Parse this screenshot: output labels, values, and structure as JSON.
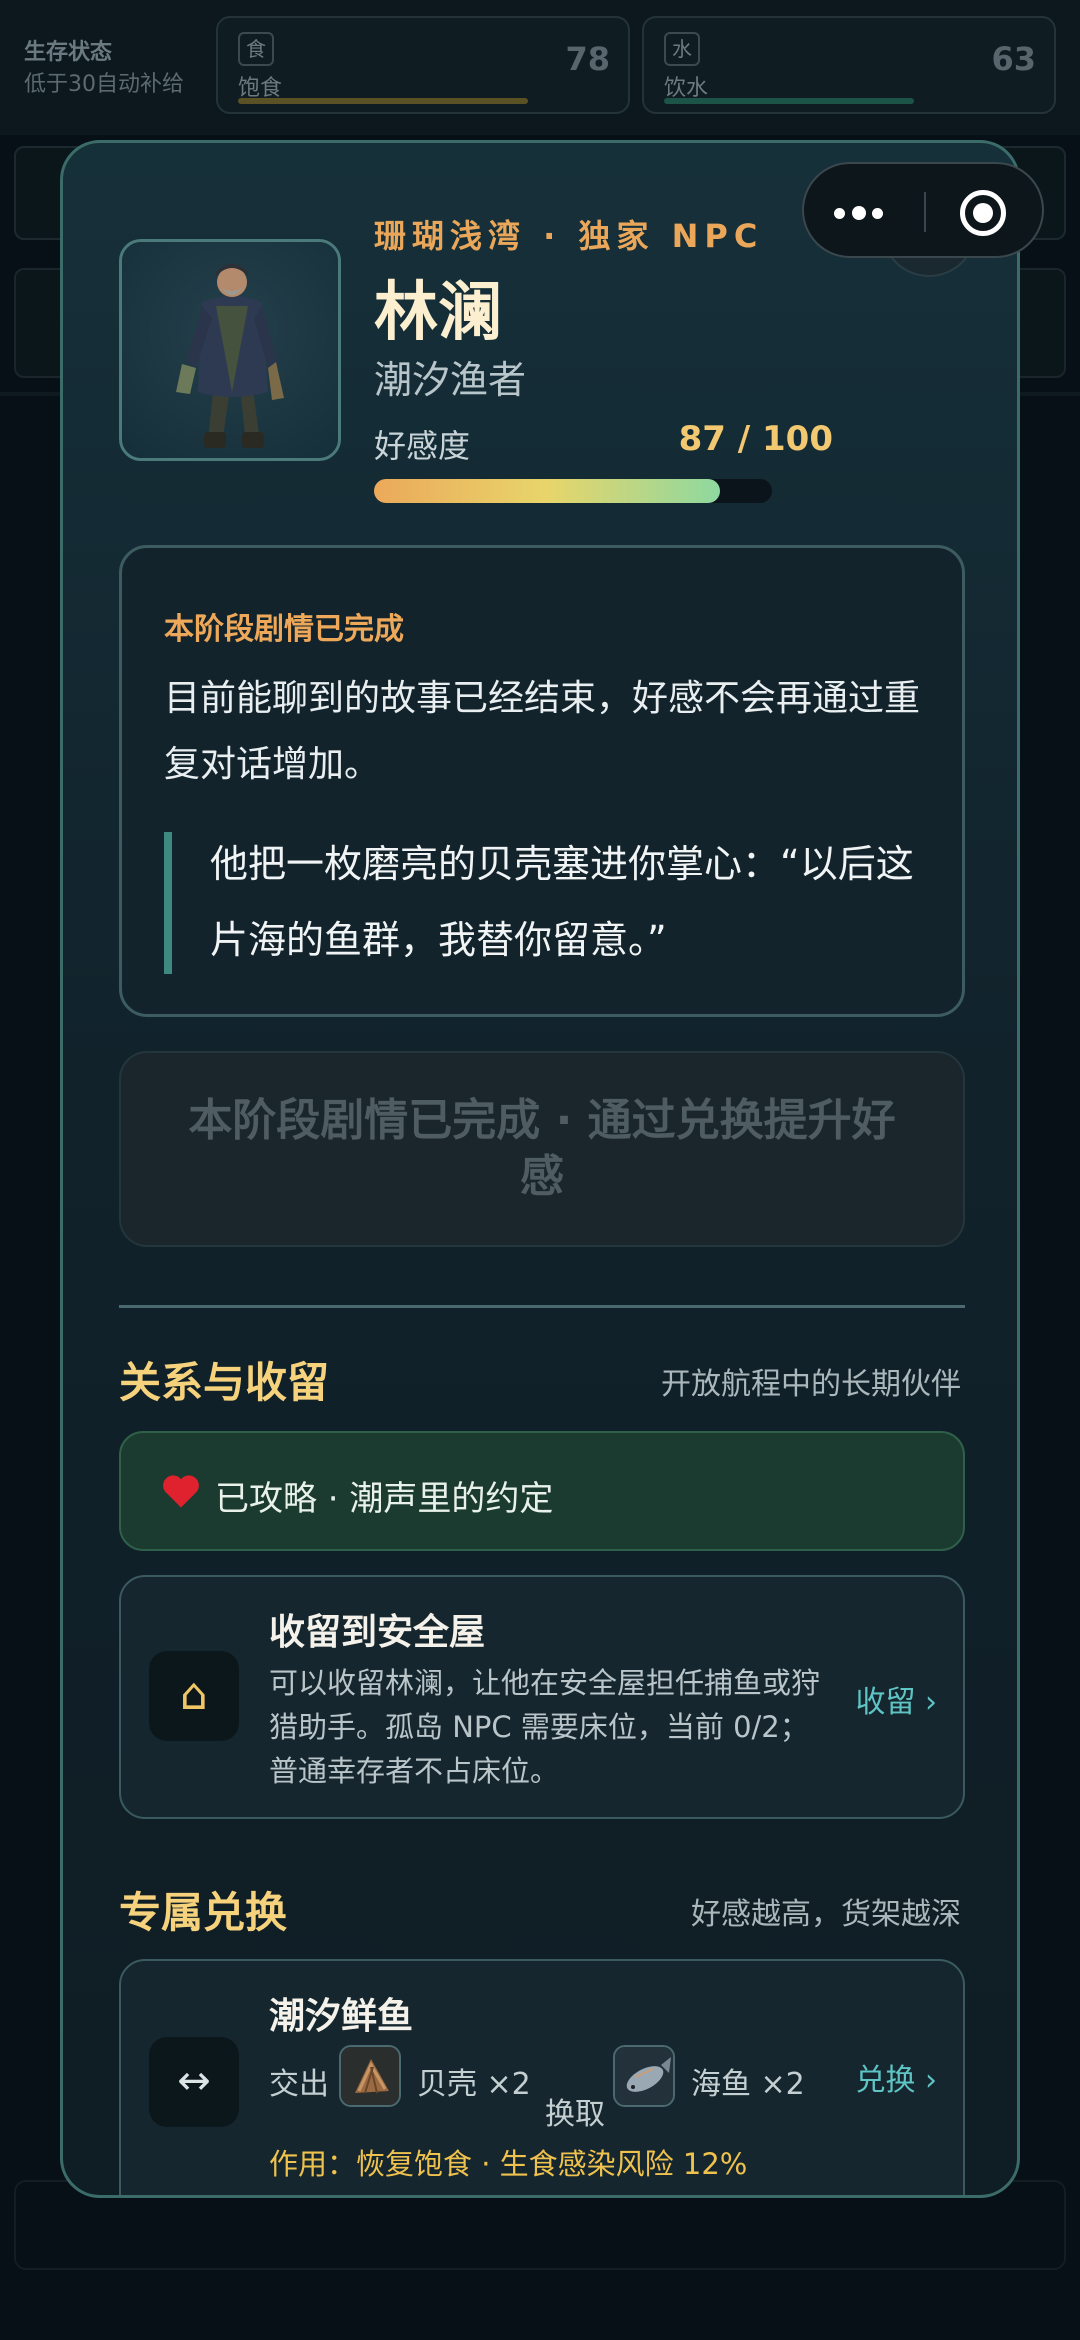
{
  "background": {
    "status_label": "生存状态",
    "status_sub": "低于30自动补给",
    "meters": [
      {
        "icon": "食",
        "name": "饱食",
        "value": "78"
      },
      {
        "icon": "水",
        "name": "饮水",
        "value": "63"
      }
    ]
  },
  "capsule": {
    "more": "more-icon",
    "close": "target-icon"
  },
  "npc": {
    "region": "珊瑚浅湾 · 独家 NPC",
    "name": "林澜",
    "role": "潮汐渔者",
    "affinity_label": "好感度",
    "affinity_text": "87 / 100",
    "affinity_value": 87,
    "affinity_max": 100
  },
  "story": {
    "title": "本阶段剧情已完成",
    "desc": "目前能聊到的故事已经结束，好感不会再通过重复对话增加。",
    "quote": "他把一枚磨亮的贝壳塞进你掌心：“以后这片海的鱼群，我替你留意。”"
  },
  "exchange_button": "本阶段剧情已完成 · 通过兑换提升好感",
  "relation": {
    "title": "关系与收留",
    "hint": "开放航程中的长期伙伴",
    "bond": "已攻略 · 潮声里的约定",
    "shelter_title": "收留到安全屋",
    "shelter_desc": "可以收留林澜，让他在安全屋担任捕鱼或狩猎助手。孤岛 NPC 需要床位，当前 0/2；普通幸存者不占床位。",
    "shelter_action": "收留 ›",
    "shelter_icon": "⌂"
  },
  "trade": {
    "title": "专属兑换",
    "hint": "好感越高，货架越深",
    "item_title": "潮汐鲜鱼",
    "give_label": "交出",
    "give_item": "贝壳 ×2",
    "get_label": "换取",
    "get_item": "海鱼 ×2",
    "effect": "作用：恢复饱食 · 生食感染风险 12%",
    "action": "兑换 ›",
    "icon": "↔"
  },
  "colors": {
    "accent_orange": "#eaa75a",
    "accent_gold": "#f6d27d",
    "link_cyan": "#5ec4c4",
    "modal_border": "#3c6c6a"
  }
}
